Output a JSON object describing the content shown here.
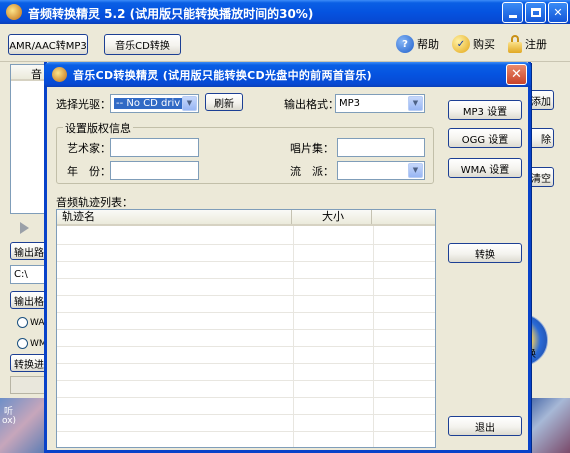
{
  "main": {
    "title": "音频转换精灵 5.2 (试用版只能转换播放时间的30%)",
    "toolbar": {
      "amr_button": "AMR/AAC转MP3",
      "cd_button": "音乐CD转换",
      "help": "帮助",
      "buy": "购买",
      "register": "注册"
    },
    "partial_labels": {
      "list_corner": "音",
      "output_path": "输出路",
      "path_value": "C:\\",
      "output_format": "输出格",
      "radio_1": "WA",
      "radio_2": "WM",
      "convert_progress": "转换进",
      "desktop_text_1": "听",
      "desktop_text_2": "ox)"
    },
    "right_buttons": [
      "添加",
      "除",
      "清空",
      "换"
    ]
  },
  "dialog": {
    "title": "音乐CD转换精灵 (试用版只能转换CD光盘中的前两首音乐)",
    "select_drive_label": "选择光驱：",
    "drive_value": "-- No CD driv",
    "refresh_button": "刷新",
    "output_format_label": "输出格式：",
    "output_format_value": "MP3",
    "copyright_group": "设置版权信息",
    "artist_label": "艺术家：",
    "album_label": "唱片集：",
    "year_label": "年　份：",
    "genre_label": "流　派：",
    "track_list_label": "音频轨迹列表：",
    "columns": [
      "轨迹名",
      "大小"
    ],
    "mp3_settings": "MP3 设置",
    "ogg_settings": "OGG 设置",
    "wma_settings": "WMA 设置",
    "convert_button": "转换",
    "exit_button": "退出"
  },
  "colors": {
    "title_blue": "#0553e0",
    "dialog_face": "#ece9d8",
    "close_red": "#c9432a"
  }
}
